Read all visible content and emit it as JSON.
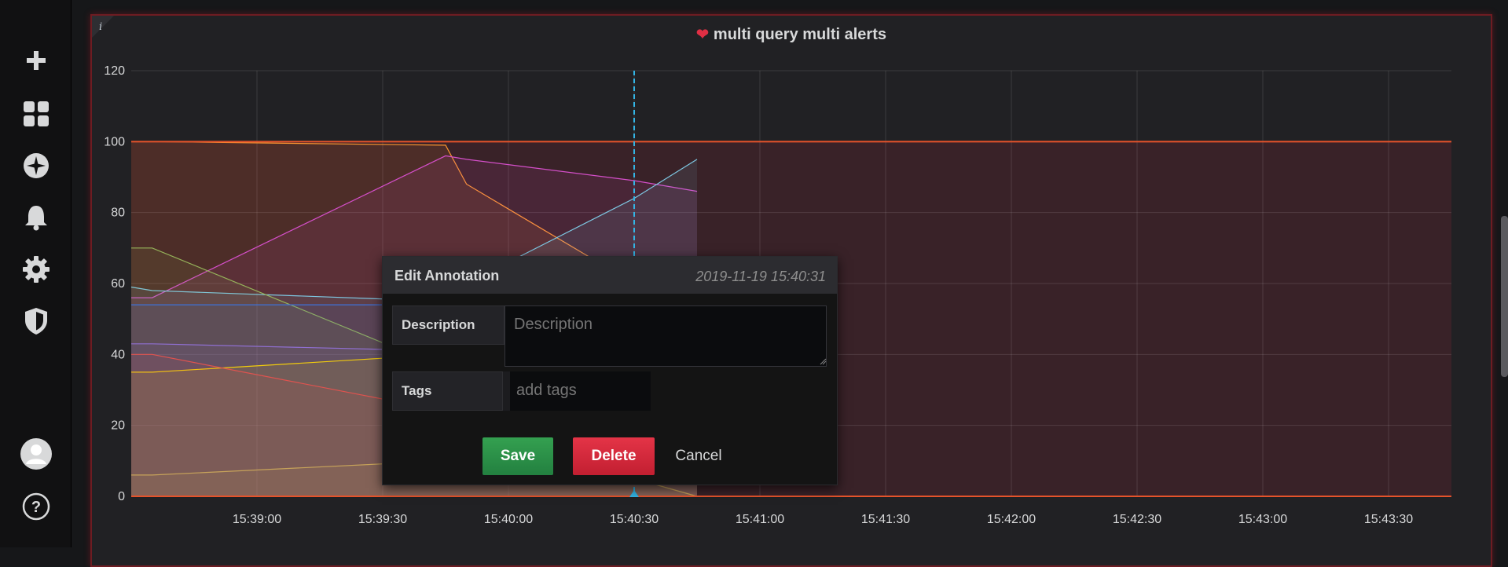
{
  "sidebar": {
    "items": [
      "add-icon",
      "dashboards-icon",
      "explore-icon",
      "alerting-icon",
      "configuration-icon",
      "server-admin-icon",
      "profile-avatar-icon",
      "help-icon"
    ]
  },
  "panel": {
    "info_icon": "i",
    "title": "multi query multi alerts",
    "title_icon": "broken-heart-icon",
    "alert_color": "#e02f44"
  },
  "chart_data": {
    "type": "area",
    "x": [
      "15:38:30",
      "15:38:35",
      "15:39:45",
      "15:39:50",
      "15:40:30",
      "15:40:45"
    ],
    "x_ticks": [
      "15:39:00",
      "15:39:30",
      "15:40:00",
      "15:40:30",
      "15:41:00",
      "15:41:30",
      "15:42:00",
      "15:42:30",
      "15:43:00",
      "15:43:30"
    ],
    "y_ticks": [
      "0",
      "20",
      "40",
      "60",
      "80",
      "100",
      "120"
    ],
    "ylim": [
      0,
      120
    ],
    "threshold": 100,
    "annotation_time": "15:40:30",
    "series": [
      {
        "color": "#ff9830",
        "values": [
          100,
          100,
          99,
          88,
          60,
          40
        ]
      },
      {
        "color": "#d44fc9",
        "values": [
          56,
          56,
          96,
          95,
          89,
          86
        ]
      },
      {
        "color": "#7ec8e3",
        "values": [
          59,
          58,
          55,
          60,
          84,
          95
        ]
      },
      {
        "color": "#96b35a",
        "values": [
          70,
          70,
          36,
          30,
          18,
          10
        ]
      },
      {
        "color": "#3d71d9",
        "values": [
          54,
          54,
          54,
          50,
          45,
          40
        ]
      },
      {
        "color": "#8f6fd0",
        "values": [
          43,
          43,
          41,
          40,
          35,
          30
        ]
      },
      {
        "color": "#f2cc0c",
        "values": [
          35,
          35,
          40,
          40,
          38,
          35
        ]
      },
      {
        "color": "#e0534f",
        "values": [
          40,
          40,
          24,
          20,
          15,
          10
        ]
      },
      {
        "color": "#c7a35a",
        "values": [
          6,
          6,
          10,
          10,
          5,
          0
        ]
      }
    ]
  },
  "dialog": {
    "title": "Edit Annotation",
    "timestamp": "2019-11-19 15:40:31",
    "description_label": "Description",
    "description_placeholder": "Description",
    "tags_label": "Tags",
    "tags_placeholder": "add tags",
    "save_label": "Save",
    "delete_label": "Delete",
    "cancel_label": "Cancel"
  }
}
